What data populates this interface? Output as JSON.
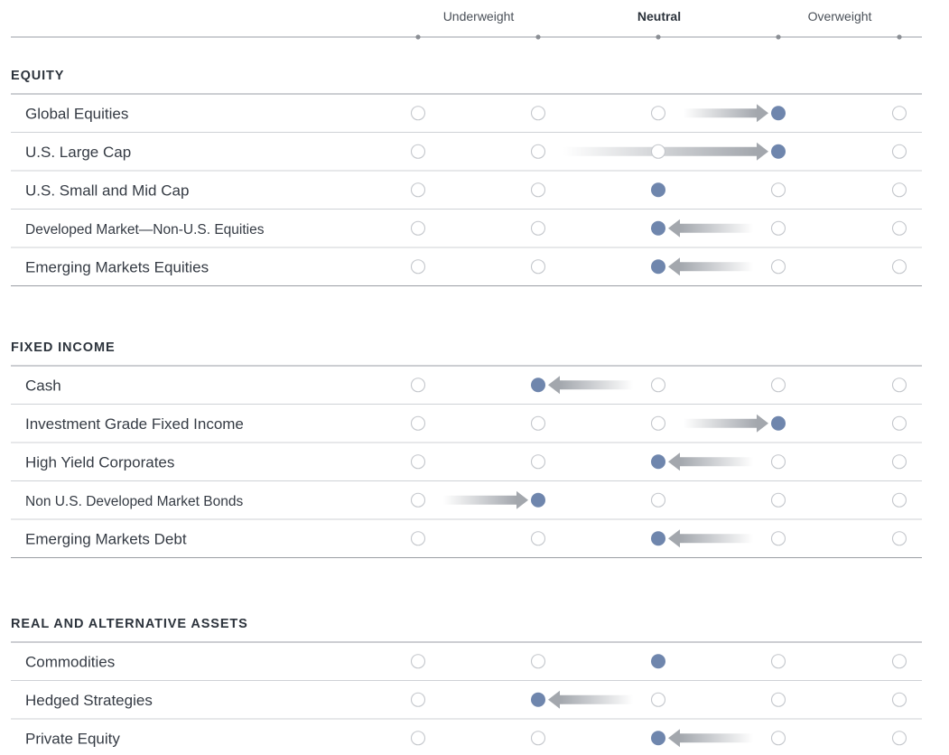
{
  "chart_data": {
    "type": "table",
    "columns": [
      "",
      "Underweight",
      "",
      "Neutral",
      "",
      "Overweight",
      ""
    ],
    "header": {
      "underweight_label": "Underweight",
      "neutral_label": "Neutral",
      "overweight_label": "Overweight"
    },
    "scale_levels": 5,
    "level_meaning": "1 = most underweight, 3 = neutral, 5 = most overweight",
    "sections": [
      {
        "title": "EQUITY",
        "rows": [
          {
            "label": "Global Equities",
            "position": 4,
            "previous": 3
          },
          {
            "label": "U.S. Large Cap",
            "position": 4,
            "previous": 2
          },
          {
            "label": "U.S. Small and Mid Cap",
            "position": 3,
            "previous": null
          },
          {
            "label": "Developed Market—Non-U.S. Equities",
            "position": 3,
            "previous": 4
          },
          {
            "label": "Emerging Markets Equities",
            "position": 3,
            "previous": 4
          }
        ]
      },
      {
        "title": "FIXED INCOME",
        "rows": [
          {
            "label": "Cash",
            "position": 2,
            "previous": 3
          },
          {
            "label": "Investment Grade Fixed Income",
            "position": 4,
            "previous": 3
          },
          {
            "label": "High Yield Corporates",
            "position": 3,
            "previous": 4
          },
          {
            "label": "Non U.S. Developed Market Bonds",
            "position": 2,
            "previous": 1
          },
          {
            "label": "Emerging Markets Debt",
            "position": 3,
            "previous": 4
          }
        ]
      },
      {
        "title": "REAL AND ALTERNATIVE ASSETS",
        "rows": [
          {
            "label": "Commodities",
            "position": 3,
            "previous": null
          },
          {
            "label": "Hedged Strategies",
            "position": 2,
            "previous": 3
          },
          {
            "label": "Private Equity",
            "position": 3,
            "previous": 4
          }
        ]
      }
    ],
    "colors": {
      "filled_dot": "#6f86ad",
      "empty_dot_stroke": "#c4c7cc",
      "arrow_dark": "#a3a7ad",
      "arrow_light": "#eceef0",
      "rule": "#9a9ea4",
      "row_rule": "#cfd2d6",
      "header_tick": "#8a8e94"
    }
  }
}
